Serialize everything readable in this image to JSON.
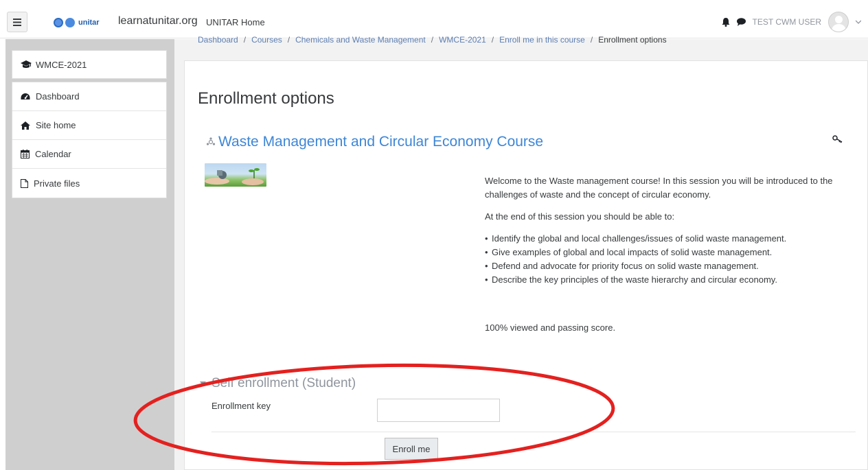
{
  "header": {
    "logo_text": "unitar",
    "site_name": "learnatunitar.org",
    "home_link": "UNITAR Home",
    "username": "TEST CWM USER"
  },
  "breadcrumb": {
    "items": [
      "Dashboard",
      "Courses",
      "Chemicals and Waste Management",
      "WMCE-2021",
      "Enroll me in this course"
    ],
    "current": "Enrollment options"
  },
  "sidebar": {
    "course": "WMCE-2021",
    "items": [
      {
        "label": "Dashboard",
        "icon": "dashboard-icon"
      },
      {
        "label": "Site home",
        "icon": "home-icon"
      },
      {
        "label": "Calendar",
        "icon": "calendar-icon"
      },
      {
        "label": "Private files",
        "icon": "file-icon"
      }
    ]
  },
  "main": {
    "title": "Enrollment options",
    "course_title": "Waste Management and Circular Economy Course",
    "summary": {
      "intro": "Welcome to the Waste management course! In this session you will be introduced to the challenges of waste and the concept of circular economy.",
      "lead": "At the end of this session you should be able to:",
      "objectives": [
        "Identify the global and local challenges/issues of solid waste management.",
        "Give examples of global and local impacts of solid waste management.",
        "Defend and advocate for priority focus on solid waste management.",
        "Describe the key principles of the waste hierarchy and circular economy."
      ],
      "completion": "100% viewed and passing score."
    },
    "enrollment": {
      "section_title": "Self enrollment (Student)",
      "key_label": "Enrollment key",
      "key_value": "",
      "button_label": "Enroll me"
    }
  },
  "colors": {
    "link": "#3d86d6",
    "annotation": "#e3211f",
    "drawer_bg": "#cfcfcf"
  }
}
